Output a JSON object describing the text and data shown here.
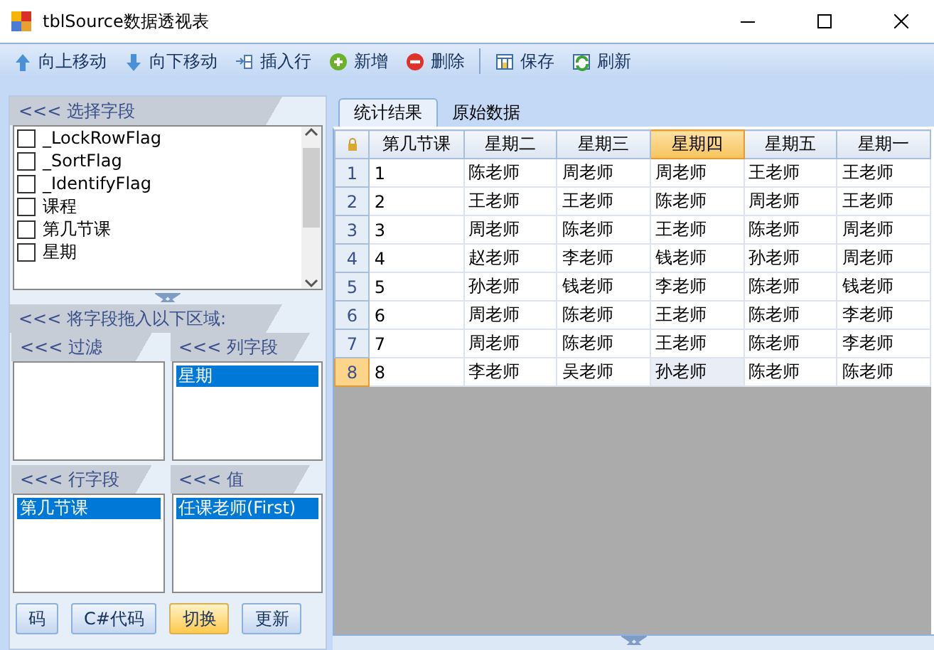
{
  "window": {
    "title": "tblSource数据透视表"
  },
  "toolbar": [
    {
      "kind": "up",
      "label": "向上移动"
    },
    {
      "kind": "down",
      "label": "向下移动"
    },
    {
      "kind": "insert",
      "label": "插入行"
    },
    {
      "kind": "add",
      "label": "新增"
    },
    {
      "kind": "delete",
      "label": "删除"
    },
    {
      "kind": "separator"
    },
    {
      "kind": "save",
      "label": "保存"
    },
    {
      "kind": "refresh",
      "label": "刷新"
    }
  ],
  "field_panel": {
    "header": "<<< 选择字段",
    "fields": [
      {
        "label": "_LockRowFlag",
        "checked": false
      },
      {
        "label": "_SortFlag",
        "checked": false
      },
      {
        "label": "_IdentifyFlag",
        "checked": false
      },
      {
        "label": "课程",
        "checked": false
      },
      {
        "label": "第几节课",
        "checked": false
      },
      {
        "label": "星期",
        "checked": false
      }
    ]
  },
  "drop_panel": {
    "header": "<<< 将字段拖入以下区域:",
    "zones": [
      {
        "header": "<<< 过滤"
      },
      {
        "header": "<<< 列字段",
        "items": [
          "星期"
        ]
      },
      {
        "header": "<<< 行字段",
        "items": [
          "第几节课"
        ]
      },
      {
        "header": "<<< 值",
        "items": [
          "任课老师(First)"
        ]
      }
    ]
  },
  "buttons": [
    {
      "label": "码",
      "highlighted": false
    },
    {
      "label": "C#代码",
      "highlighted": false
    },
    {
      "label": "切换",
      "highlighted": true
    },
    {
      "label": "更新",
      "highlighted": false
    }
  ],
  "tabs": [
    {
      "label": "统计结果",
      "selected": true
    },
    {
      "label": "原始数据",
      "selected": false
    }
  ],
  "table": {
    "columns": [
      {
        "label": "第几节课",
        "selected": false
      },
      {
        "label": "星期二",
        "selected": false
      },
      {
        "label": "星期三",
        "selected": false
      },
      {
        "label": "星期四",
        "selected": true
      },
      {
        "label": "星期五",
        "selected": false
      },
      {
        "label": "星期一",
        "selected": false
      }
    ],
    "rows": [
      {
        "header": "1",
        "selected": false,
        "cells": [
          "1",
          "陈老师",
          "周老师",
          "周老师",
          "王老师",
          "王老师"
        ]
      },
      {
        "header": "2",
        "selected": false,
        "cells": [
          "2",
          "王老师",
          "王老师",
          "陈老师",
          "周老师",
          "王老师"
        ]
      },
      {
        "header": "3",
        "selected": false,
        "cells": [
          "3",
          "周老师",
          "陈老师",
          "王老师",
          "陈老师",
          "周老师"
        ]
      },
      {
        "header": "4",
        "selected": false,
        "cells": [
          "4",
          "赵老师",
          "李老师",
          "钱老师",
          "孙老师",
          "周老师"
        ]
      },
      {
        "header": "5",
        "selected": false,
        "cells": [
          "5",
          "孙老师",
          "钱老师",
          "李老师",
          "陈老师",
          "钱老师"
        ]
      },
      {
        "header": "6",
        "selected": false,
        "cells": [
          "6",
          "周老师",
          "陈老师",
          "王老师",
          "陈老师",
          "李老师"
        ]
      },
      {
        "header": "7",
        "selected": false,
        "cells": [
          "7",
          "周老师",
          "陈老师",
          "王老师",
          "陈老师",
          "李老师"
        ]
      },
      {
        "header": "8",
        "selected": true,
        "cells": [
          "8",
          "李老师",
          "吴老师",
          "孙老师",
          "陈老师",
          "陈老师"
        ]
      }
    ]
  }
}
